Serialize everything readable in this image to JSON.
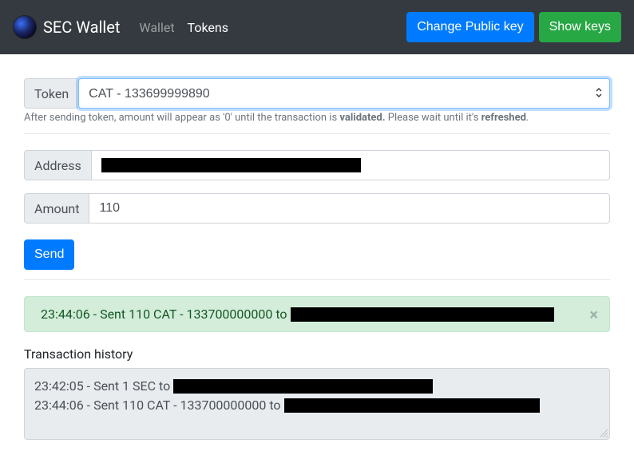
{
  "navbar": {
    "brand": "SEC Wallet",
    "wallet_link": "Wallet",
    "tokens_link": "Tokens",
    "change_key_btn": "Change Public key",
    "show_keys_btn": "Show keys"
  },
  "token": {
    "label": "Token",
    "selected": "CAT - 133699999890"
  },
  "hint": {
    "pre": "After sending token, amount will appear as '0' until the transaction is ",
    "bold1": "validated.",
    "mid": " Please wait until it's ",
    "bold2": "refreshed",
    "post": "."
  },
  "address": {
    "label": "Address"
  },
  "amount": {
    "label": "Amount",
    "value": "110"
  },
  "send_btn": "Send",
  "alert": {
    "text": "23:44:06 - Sent 110 CAT - 133700000000 to "
  },
  "history": {
    "title": "Transaction history",
    "rows": [
      "23:42:05 - Sent 1 SEC to ",
      "23:44:06 - Sent 110 CAT - 133700000000 to "
    ]
  }
}
